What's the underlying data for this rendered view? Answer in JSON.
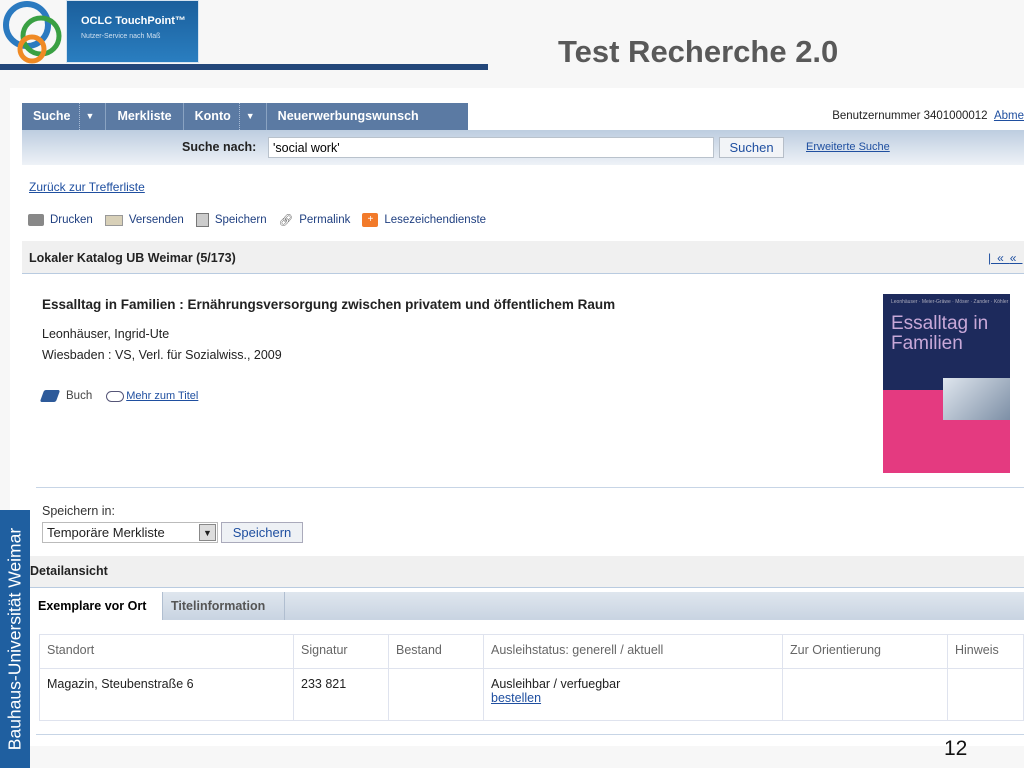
{
  "slide": {
    "title": "Test Recherche 2.0",
    "page_number": "12",
    "side_label": "Bauhaus-Universität Weimar"
  },
  "brand": {
    "name": "OCLC TouchPoint™",
    "tagline": "Nutzer-Service nach Maß"
  },
  "nav": {
    "items": [
      "Suche",
      "Merkliste",
      "Konto",
      "Neuerwerbungswunsch"
    ],
    "user_text": "Benutzernummer 3401000012",
    "logout": "Abme"
  },
  "search": {
    "label": "Suche nach:",
    "value": "'social work'",
    "button": "Suchen",
    "advanced": "Erweiterte Suche"
  },
  "back_link": "Zurück zur Trefferliste",
  "tools": [
    "Drucken",
    "Versenden",
    "Speichern",
    "Permalink",
    "Lesezeichendienste"
  ],
  "catalog": {
    "label": "Lokaler Katalog UB Weimar (5/173)",
    "first": "|«",
    "prev": "«"
  },
  "record": {
    "title": "Essalltag in Familien : Ernährungsversorgung zwischen privatem und öffentlichem Raum",
    "author": "Leonhäuser, Ingrid-Ute",
    "publication": "Wiesbaden : VS, Verl. für Sozialwiss., 2009",
    "type": "Buch",
    "more": "Mehr zum Titel",
    "cover_title": "Essalltag in Familien"
  },
  "save": {
    "label": "Speichern in:",
    "selected": "Temporäre Merkliste",
    "button": "Speichern"
  },
  "detail": {
    "label": "Detailansicht",
    "tabs": [
      "Exemplare vor Ort",
      "Titelinformation"
    ]
  },
  "holdings": {
    "headers": [
      "Standort",
      "Signatur",
      "Bestand",
      "Ausleihstatus: generell / aktuell",
      "Zur Orientierung",
      "Hinweis"
    ],
    "rows": [
      {
        "standort": "Magazin, Steubenstraße 6",
        "signatur": "233 821",
        "bestand": "",
        "status": "Ausleihbar / verfuegbar",
        "action": "bestellen",
        "orientierung": "",
        "hinweis": ""
      }
    ]
  },
  "colors": {
    "nav": "#5b7aa3",
    "accent": "#1f5fa0",
    "link": "#1f4fa0"
  }
}
